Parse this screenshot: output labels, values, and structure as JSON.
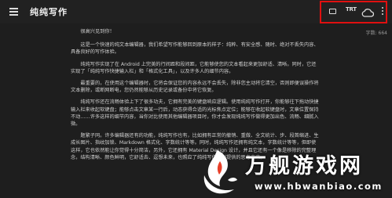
{
  "app": {
    "title": "纯纯写作",
    "menu_icon": "menu-icon"
  },
  "toolbar": {
    "fullscreen_icon": "fullscreen-icon",
    "font_label": "TRT",
    "cloud_icon": "cloud-sync-icon",
    "more_icon": "more-vert-icon",
    "highlight_color": "#e01010"
  },
  "status": {
    "word_count": "字数: 664"
  },
  "document": {
    "greeting": "很高兴见到你！",
    "paragraphs": [
      "这是一个快速的纯文本编辑器，我们希望写作能够回到原本的样子：纯粹、有安全感、随时、绝对不丢失内容、具备良好的写作体验。",
      "纯纯写作实现了在 Android 上完美的行间距和段间距，它能够使您的文本看起来更加舒适、清晰。同时，它还实现了「纯纯写作快捷输入栏」和「格式化工具」，以及许多人的细节内容。",
      "最重要的，在使用这个编辑器时，它将会保证您的内容永远不会丢失，除非您主动将它清空，否则即便误操作将文本删除，或断网断电，您仍然能够从历史记录或备份中将它恢复。",
      "纯纯写作还在流畅体验上下了很多功夫，它拥有完美的键盘响应逻辑。使用纯纯写作打开，你能够往下拖动快捷输入栏来收起软键盘；能够点击文章某一行后，动态获得合适的光标焦点定位；能够在收起软键盘时，文章位置保持不动……许多这样的细节内容，当你对比使用其他编辑器项目时，你才会发现纯纯写作做得更加出色、流畅、细腻入微。",
      "题繁子同。许多编辑器还有的功能，纯纯写作也有，比如拥有正常的撤销、重做、全文统计、步、段首缩进、生成长图片、指纹加锁、Markdown 格式化、字数统计等等。同时，纯纯写作还拥有纯文本，字数统计等等，但即使这样，它也依然能让你觉得十分简洁，另外，它还拥有 Material Design 设计，并且它还有一个像是移除的完整理念，结构清晰、颜色鲜明，它舒适去、逗想未来，也照应了纯纯写作特别提供的思考未来。"
    ]
  },
  "watermark": {
    "brand": "万舰游戏网",
    "url": "www.hbwanbiao.com"
  }
}
